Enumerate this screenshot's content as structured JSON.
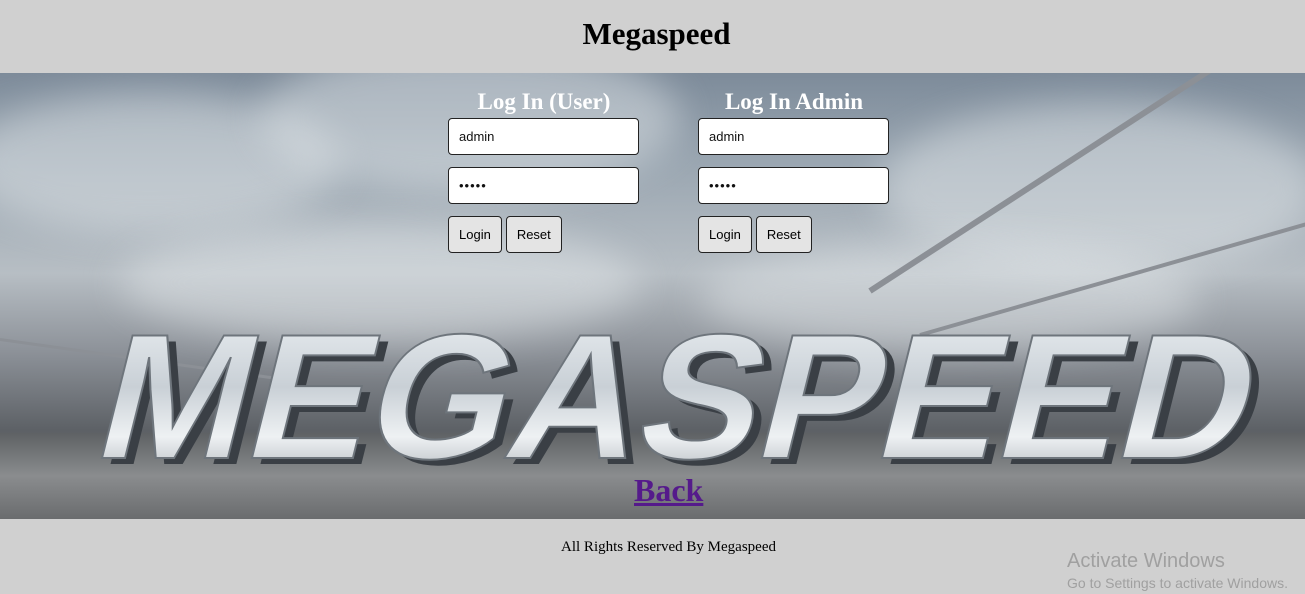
{
  "header": {
    "title": "Megaspeed"
  },
  "hero": {
    "logo_text": "MEGASPEED"
  },
  "user_login": {
    "heading": "Log In (User)",
    "username_value": "admin",
    "password_value": "•••••",
    "login_label": "Login",
    "reset_label": "Reset"
  },
  "admin_login": {
    "heading": "Log In Admin",
    "username_value": "admin",
    "password_value": "•••••",
    "login_label": "Login",
    "reset_label": "Reset"
  },
  "back": {
    "label": "Back"
  },
  "footer": {
    "copyright": "All Rights Reserved By Megaspeed"
  },
  "watermark": {
    "line1": "Activate Windows",
    "line2": "Go to Settings to activate Windows."
  },
  "colors": {
    "page_bg": "#d0d0d0",
    "link_visited": "#551a8b",
    "heading_on_hero": "#ffffff"
  }
}
